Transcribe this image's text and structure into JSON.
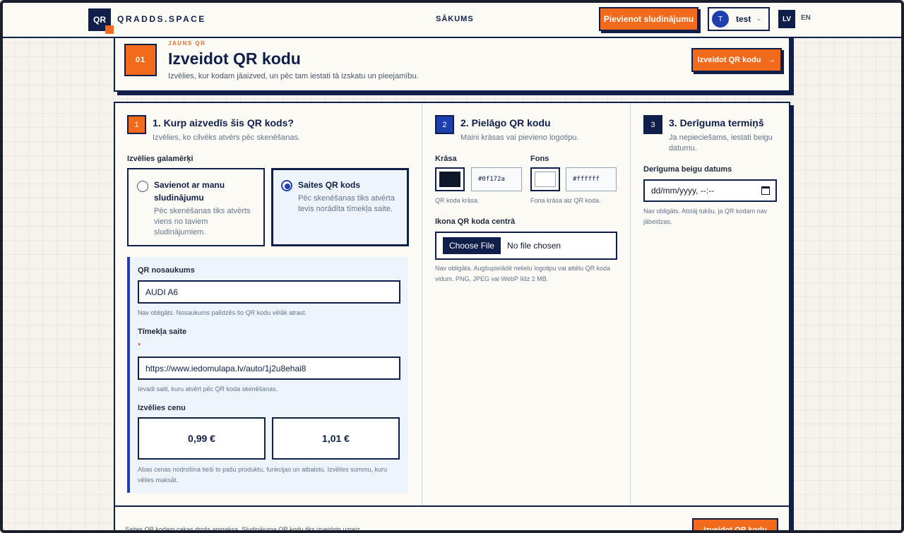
{
  "header": {
    "logo_mark": "QR",
    "logo_text": "QRADDS.SPACE",
    "nav_home": "SĀKUMS",
    "add_ad_label": "Pievienot sludinājumu",
    "user_initial": "T",
    "user_name": "test",
    "lang_active": "LV",
    "lang_other": "EN"
  },
  "intro": {
    "step_number": "01",
    "eyebrow": "JAUNS QR",
    "title": "Izveidot QR kodu",
    "subtitle": "Izvēlies, kur kodam jāaizved, un pēc tam iestati tā izskatu un pieejamību.",
    "create_label": "Izveidot QR kodu",
    "create_arrow": "→"
  },
  "step1": {
    "badge": "1",
    "title": "1. Kurp aizvedīs šis QR kods?",
    "subtitle": "Izvēlies, ko cilvēks atvērs pēc skenēšanas.",
    "destination_label": "Izvēlies galamērķi",
    "options": [
      {
        "title": "Savienot ar manu sludinājumu",
        "desc": "Pēc skenēšanas tiks atvērts viens no taviem sludinājumiem.",
        "selected": false
      },
      {
        "title": "Saites QR kods",
        "desc": "Pēc skenēšanas tiks atvērta tevis norādīta tīmekļa saite.",
        "selected": true
      }
    ],
    "name_label": "QR nosaukums",
    "name_value": "AUDI A6",
    "name_hint": "Nav obligāts. Nosaukums palīdzēs šo QR kodu vēlāk atrast.",
    "url_label": "Tīmekļa saite",
    "url_required": "*",
    "url_value": "https://www.iedomulapa.lv/auto/1j2u8ehai8",
    "url_hint": "Ievadi saiti, kuru atvērt pēc QR koda skenēšanas.",
    "price_label": "Izvēlies cenu",
    "prices": [
      "0,99 €",
      "1,01 €"
    ],
    "price_hint": "Abas cenas nodrošina tieši to pašu produktu, funkcijas un atbalstu. Izvēlies summu, kuru vēlies maksāt."
  },
  "step2": {
    "badge": "2",
    "title": "2. Pielāgo QR kodu",
    "subtitle": "Maini krāsas vai pievieno logotipu.",
    "color_label": "Krāsa",
    "color_value": "#0f172a",
    "color_hint": "QR koda krāsa.",
    "bg_label": "Fons",
    "bg_value": "#ffffff",
    "bg_hint": "Fona krāsa aiz QR koda.",
    "icon_label": "Ikona QR koda centrā",
    "file_button": "Choose File",
    "file_status": "No file chosen",
    "icon_hint": "Nav obligāta. Augšupielādē nelielu logotipu vai attēlu QR koda vidum. PNG, JPEG vai WebP līdz 2 MB."
  },
  "step3": {
    "badge": "3",
    "title": "3. Derīguma termiņš",
    "subtitle": "Ja nepieciešams, iestati beigu datumu.",
    "date_label": "Derīguma beigu datums",
    "date_placeholder": "dd/mm/yyyy, --:--",
    "date_hint": "Nav obligāts. Atstāj tukšu, ja QR kodam nav jābeidzas."
  },
  "footer": {
    "note": "Saites QR kodam cakas drošs apmaksa. Sludinājuma QR kodu tiks izveidots uzreiz.",
    "create_label": "Izveidot QR kodu"
  },
  "colors": {
    "accent": "#f26b1d",
    "navy": "#0f1f4a",
    "blue": "#1e40af"
  }
}
